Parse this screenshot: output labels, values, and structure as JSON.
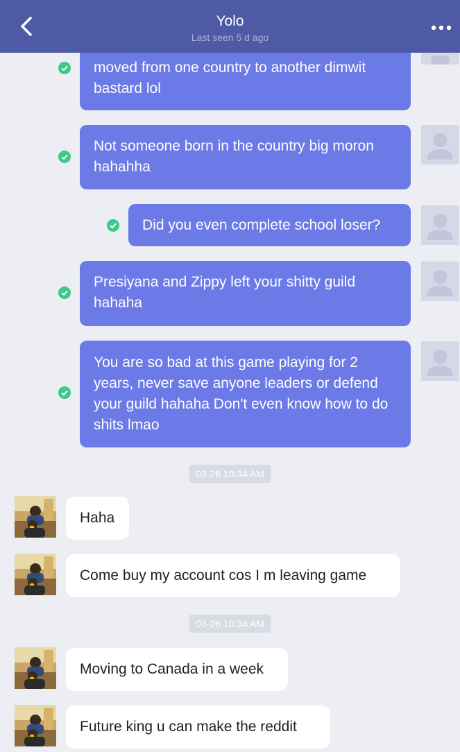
{
  "header": {
    "title": "Yolo",
    "subtitle": "Last seen 5 d ago",
    "back_icon": "chevron-left-icon",
    "more_icon": "more-horizontal-icon"
  },
  "messages_sent": [
    {
      "text": "moved from one country to another dimwit bastard lol"
    },
    {
      "text": "Not someone born in  the country big moron hahahha"
    },
    {
      "text": "Did you even complete school loser?"
    },
    {
      "text": "Presiyana and Zippy left your shitty guild hahaha"
    },
    {
      "text": "You are so bad at this game playing for 2 years, never save anyone leaders or defend your guild hahaha Don't even know how to do shits lmao"
    }
  ],
  "timestamps": [
    "03-26 10:34 AM",
    "03-26 10:34 AM"
  ],
  "messages_received": [
    {
      "text": "Haha"
    },
    {
      "text": "Come buy my account cos I m leaving game"
    },
    {
      "text": "Moving to Canada in a week"
    },
    {
      "text": "Future king  u can make the reddit"
    }
  ],
  "colors": {
    "header_bg": "#4f5aa6",
    "sent_bubble": "#6b7ae6",
    "received_bubble": "#ffffff",
    "read_check": "#3ec98a",
    "background": "#eceef3"
  }
}
